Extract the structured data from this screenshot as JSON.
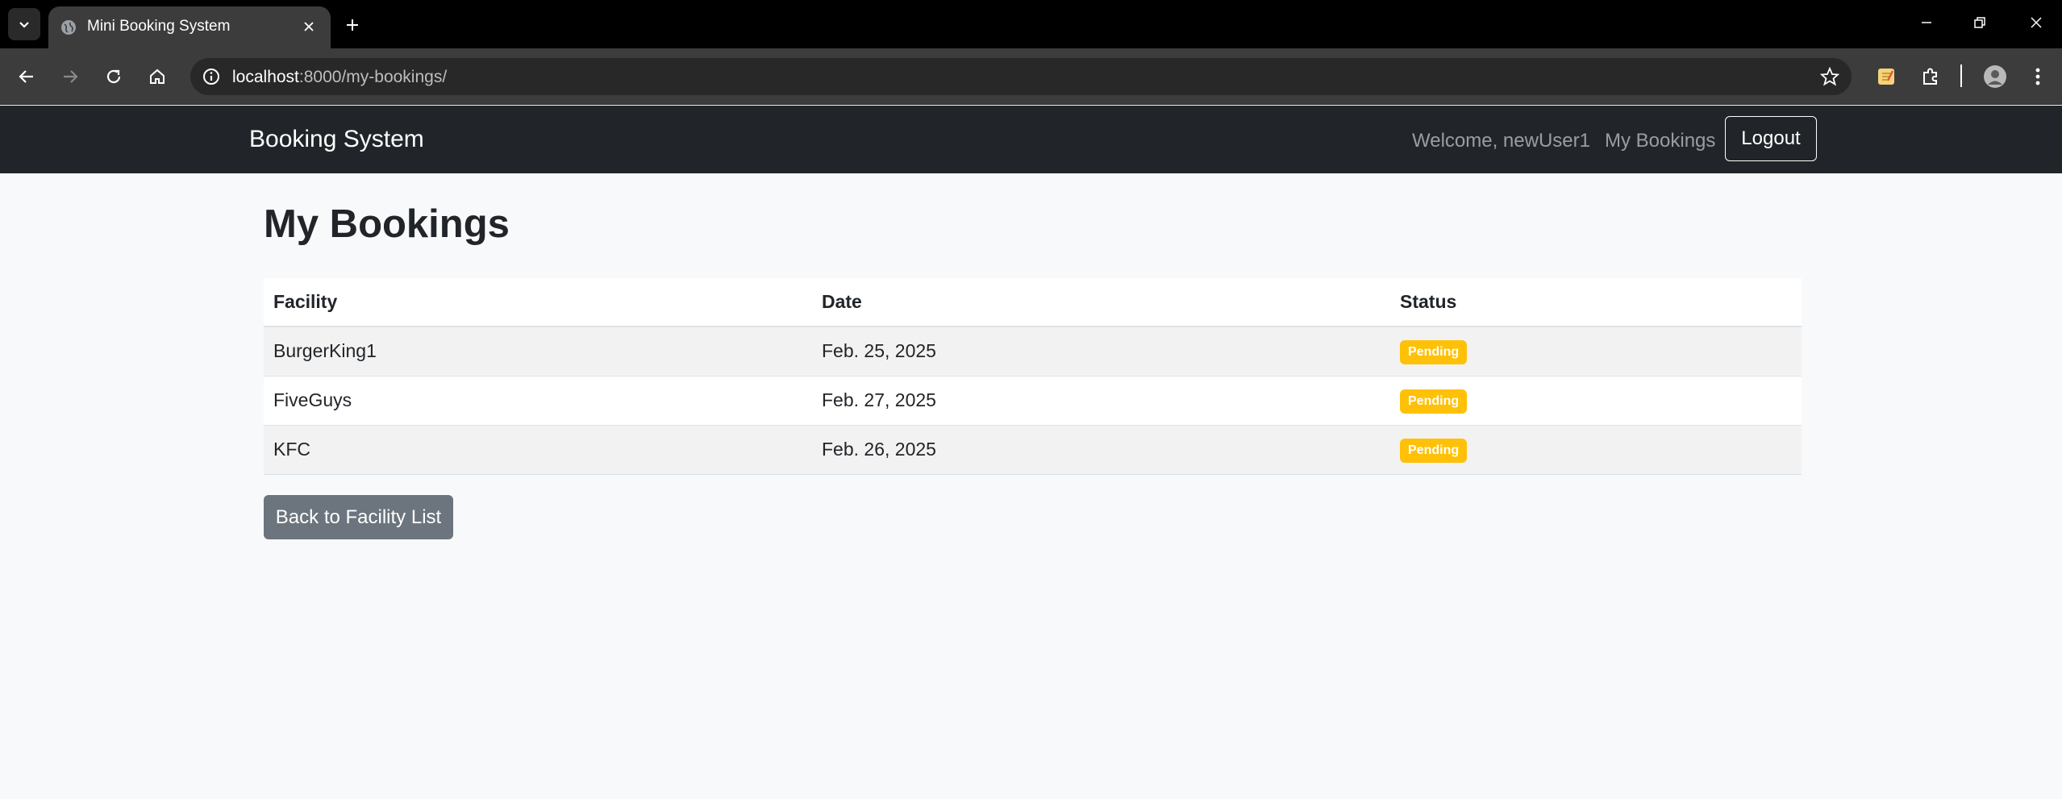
{
  "browser": {
    "tab_title": "Mini Booking System",
    "url_host": "localhost",
    "url_path": ":8000/my-bookings/"
  },
  "navbar": {
    "brand": "Booking System",
    "welcome": "Welcome, newUser1",
    "my_bookings_link": "My Bookings",
    "logout_label": "Logout"
  },
  "page": {
    "heading": "My Bookings"
  },
  "table": {
    "headers": [
      "Facility",
      "Date",
      "Status"
    ],
    "rows": [
      {
        "facility": "BurgerKing1",
        "date": "Feb. 25, 2025",
        "status": "Pending"
      },
      {
        "facility": "FiveGuys",
        "date": "Feb. 27, 2025",
        "status": "Pending"
      },
      {
        "facility": "KFC",
        "date": "Feb. 26, 2025",
        "status": "Pending"
      }
    ]
  },
  "back_button_label": "Back to Facility List",
  "colors": {
    "navbar_bg": "#212529",
    "badge_warning": "#ffc107",
    "secondary_button": "#6c757d",
    "page_bg": "#f8f9fa"
  }
}
